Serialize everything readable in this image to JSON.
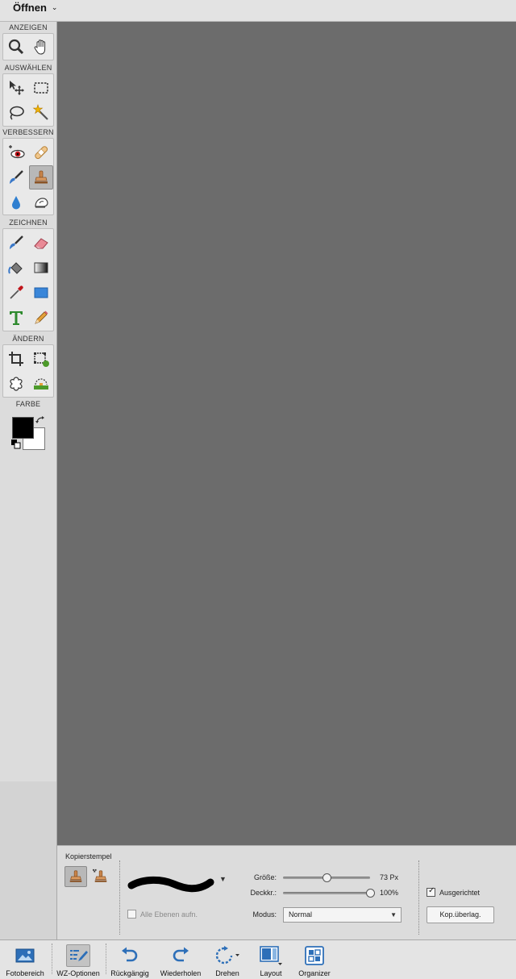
{
  "topbar": {
    "open_label": "Öffnen",
    "open_caret": "⌄"
  },
  "toolbox": {
    "sections": {
      "view": "ANZEIGEN",
      "select": "AUSWÄHLEN",
      "enhance": "VERBESSERN",
      "draw": "ZEICHNEN",
      "modify": "ÄNDERN",
      "color": "FARBE"
    },
    "tools": [
      {
        "name": "zoom-tool",
        "icon": "magnifier-icon"
      },
      {
        "name": "hand-tool",
        "icon": "hand-icon"
      },
      {
        "name": "move-tool",
        "icon": "move-icon"
      },
      {
        "name": "marquee-tool",
        "icon": "marquee-icon"
      },
      {
        "name": "lasso-tool",
        "icon": "lasso-icon"
      },
      {
        "name": "magic-wand-tool",
        "icon": "magic-wand-icon"
      },
      {
        "name": "red-eye-tool",
        "icon": "red-eye-icon"
      },
      {
        "name": "healing-brush-tool",
        "icon": "bandage-icon"
      },
      {
        "name": "smart-brush-tool",
        "icon": "smart-brush-icon"
      },
      {
        "name": "clone-stamp-tool",
        "icon": "clone-stamp-icon",
        "active": true
      },
      {
        "name": "blur-tool",
        "icon": "drop-icon"
      },
      {
        "name": "sponge-tool",
        "icon": "sponge-icon"
      },
      {
        "name": "brush-tool",
        "icon": "brush-icon"
      },
      {
        "name": "eraser-tool",
        "icon": "eraser-icon"
      },
      {
        "name": "paint-bucket-tool",
        "icon": "paint-bucket-icon"
      },
      {
        "name": "gradient-tool",
        "icon": "gradient-icon"
      },
      {
        "name": "eyedropper-tool",
        "icon": "eyedropper-icon"
      },
      {
        "name": "shape-tool",
        "icon": "rectangle-icon"
      },
      {
        "name": "type-tool",
        "icon": "type-icon"
      },
      {
        "name": "pencil-tool",
        "icon": "pencil-icon"
      },
      {
        "name": "crop-tool",
        "icon": "crop-icon"
      },
      {
        "name": "recompose-tool",
        "icon": "recompose-icon"
      },
      {
        "name": "cookie-cutter-tool",
        "icon": "cookie-cutter-icon"
      },
      {
        "name": "straighten-tool",
        "icon": "straighten-icon"
      }
    ],
    "colors": {
      "foreground": "#000000",
      "background": "#ffffff"
    }
  },
  "options": {
    "tool_name": "Kopierstempel",
    "size_label": "Größe:",
    "size_value": "73 Px",
    "size_fraction": 0.5,
    "opacity_label": "Deckkr.:",
    "opacity_value": "100%",
    "opacity_fraction": 1.0,
    "mode_label": "Modus:",
    "mode_value": "Normal",
    "all_layers_label": "Alle Ebenen aufn.",
    "all_layers_checked": false,
    "aligned_label": "Ausgerichtet",
    "aligned_checked": true,
    "overlay_button": "Kop.überlag."
  },
  "taskbar": [
    {
      "name": "photo-bin",
      "label": "Fotobereich",
      "icon": "photo-bin-icon"
    },
    {
      "name": "tool-options",
      "label": "WZ-Optionen",
      "icon": "tool-options-icon",
      "active": true
    },
    {
      "name": "undo",
      "label": "Rückgängig",
      "icon": "undo-icon"
    },
    {
      "name": "redo",
      "label": "Wiederholen",
      "icon": "redo-icon"
    },
    {
      "name": "rotate",
      "label": "Drehen",
      "icon": "rotate-icon"
    },
    {
      "name": "layout",
      "label": "Layout",
      "icon": "layout-icon"
    },
    {
      "name": "organizer",
      "label": "Organizer",
      "icon": "organizer-icon"
    }
  ],
  "accent": {
    "canvas_bg": "#6c6c6c",
    "stamp_orange": "#c8844a"
  }
}
